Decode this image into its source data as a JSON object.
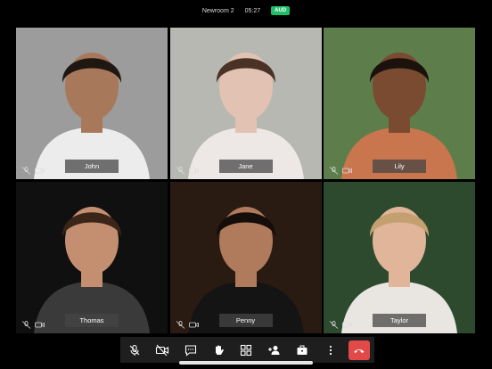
{
  "header": {
    "room": "Newroom 2",
    "timer": "05:27",
    "audio_badge": "AUD"
  },
  "participants": [
    {
      "name": "John",
      "bg": "#9c9c9c",
      "skin": "#a8785a",
      "hair": "#1f1712",
      "shirt": "#ececec"
    },
    {
      "name": "Jane",
      "bg": "#b8b8b2",
      "skin": "#e2c2b2",
      "hair": "#4a3226",
      "shirt": "#ede8e6"
    },
    {
      "name": "Lily",
      "bg": "#5d7e4a",
      "skin": "#7a4a31",
      "hair": "#1b120d",
      "shirt": "#c9754e"
    },
    {
      "name": "Thomas",
      "bg": "#101010",
      "skin": "#c48f70",
      "hair": "#3a2518",
      "shirt": "#3a3a3a"
    },
    {
      "name": "Penny",
      "bg": "#2a1b12",
      "skin": "#b07a5d",
      "hair": "#140d09",
      "shirt": "#141414"
    },
    {
      "name": "Taylor",
      "bg": "#2e4a2e",
      "skin": "#e0b59a",
      "hair": "#c4a070",
      "shirt": "#e9e6e2"
    }
  ],
  "toolbar": {
    "icons": [
      "mic-muted-icon",
      "camera-off-icon",
      "chat-icon",
      "raise-hand-icon",
      "grid-view-icon",
      "add-person-icon",
      "briefcase-icon",
      "more-icon",
      "end-call-icon"
    ]
  }
}
